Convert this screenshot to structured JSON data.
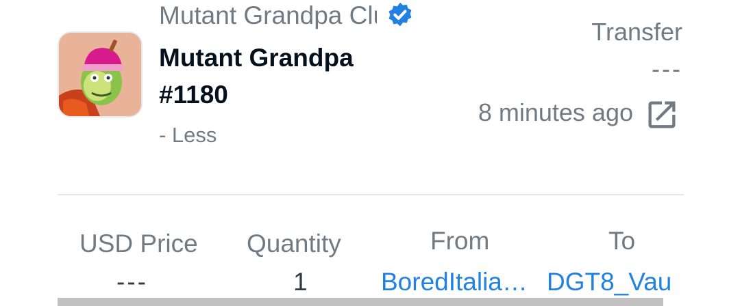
{
  "item": {
    "collection": "Mutant Grandpa Club",
    "name": "Mutant Grandpa #1180",
    "toggle_label": "- Less"
  },
  "event": {
    "type": "Transfer",
    "price": "---",
    "time": "8 minutes ago"
  },
  "details": {
    "columns": [
      {
        "header": "USD Price",
        "value": "---"
      },
      {
        "header": "Quantity",
        "value": "1"
      },
      {
        "header": "From",
        "value": "BoredItalia…"
      },
      {
        "header": "To",
        "value": "DGT8_Vau"
      }
    ]
  },
  "colors": {
    "link": "#2081e2",
    "verified": "#2081e2",
    "muted": "#707a83",
    "title": "#04111d"
  },
  "icons": {
    "verified": "verified-badge-icon",
    "external": "external-link-icon"
  }
}
